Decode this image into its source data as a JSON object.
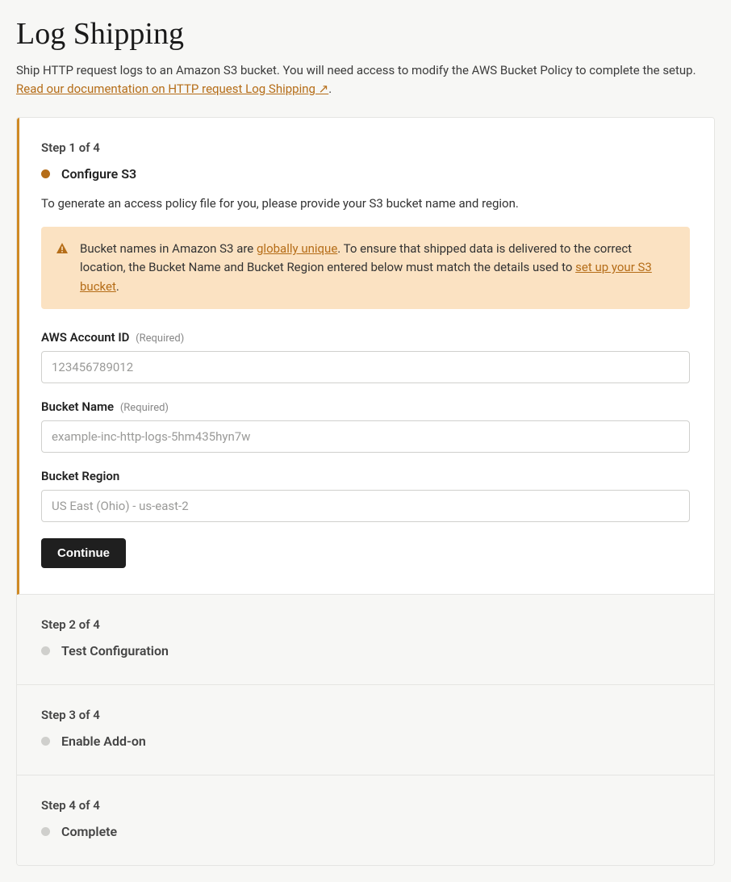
{
  "header": {
    "title": "Log Shipping",
    "intro_plain": "Ship HTTP request logs to an Amazon S3 bucket. You will need access to modify the AWS Bucket Policy to complete the setup. ",
    "doc_link_text": "Read our documentation on HTTP request Log Shipping ↗"
  },
  "steps": {
    "step1": {
      "counter": "Step 1 of 4",
      "title": "Configure S3",
      "desc": "To generate an access policy file for you, please provide your S3 bucket name and region.",
      "alert_pre": "Bucket names in Amazon S3 are ",
      "alert_link1": "globally unique",
      "alert_mid": ". To ensure that shipped data is delivered to the correct location, the Bucket Name and Bucket Region entered below must match the details used to ",
      "alert_link2": "set up your S3 bucket",
      "alert_post": ".",
      "fields": {
        "account_id": {
          "label": "AWS Account ID",
          "required": "(Required)",
          "placeholder": "123456789012"
        },
        "bucket_name": {
          "label": "Bucket Name",
          "required": "(Required)",
          "placeholder": "example-inc-http-logs-5hm435hyn7w"
        },
        "bucket_region": {
          "label": "Bucket Region",
          "placeholder": "US East (Ohio) - us-east-2"
        }
      },
      "continue_label": "Continue"
    },
    "step2": {
      "counter": "Step 2 of 4",
      "title": "Test Configuration"
    },
    "step3": {
      "counter": "Step 3 of 4",
      "title": "Enable Add-on"
    },
    "step4": {
      "counter": "Step 4 of 4",
      "title": "Complete"
    }
  }
}
